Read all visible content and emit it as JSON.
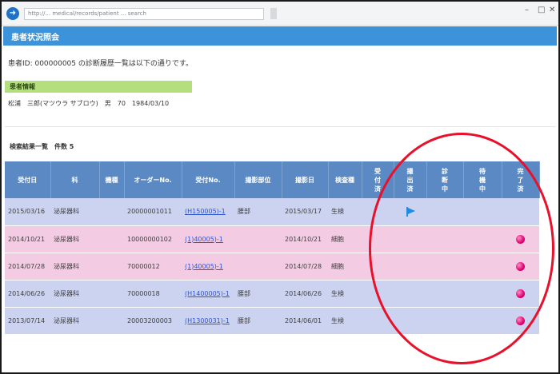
{
  "browser": {
    "url": "http://... medical/records/patient ... search",
    "tab_text": ""
  },
  "header": {
    "title": "患者状況照会"
  },
  "intro_text": "患者ID: 000000005 の診断履歴一覧は以下の通りです。",
  "patient_info": {
    "section_label": "患者情報",
    "line": "松浦　三郎(マツウラ サブロウ)　男　70　1984/03/10"
  },
  "results": {
    "title": "検索結果一覧　件数 5",
    "columns": [
      "受付日",
      "科",
      "機種",
      "オーダーNo.",
      "受付No.",
      "撮影部位",
      "撮影日",
      "検査種",
      "受付済",
      "撮出済",
      "診断中",
      "待機中",
      "完了済"
    ],
    "rows": [
      {
        "date": "2015/03/16",
        "dept": "泌尿器科",
        "model": "",
        "order": "20000001011",
        "recv": "(H150005)-1",
        "part": "腰部",
        "shot": "2015/03/17",
        "kind": "生検",
        "status": "flag",
        "color": "blue"
      },
      {
        "date": "2014/10/21",
        "dept": "泌尿器科",
        "model": "",
        "order": "10000000102",
        "recv": "(1)40005)-1",
        "part": "",
        "shot": "2014/10/21",
        "kind": "細胞",
        "status": "done",
        "color": "pink"
      },
      {
        "date": "2014/07/28",
        "dept": "泌尿器科",
        "model": "",
        "order": "70000012",
        "recv": "(1)40005)-1",
        "part": "",
        "shot": "2014/07/28",
        "kind": "細胞",
        "status": "done",
        "color": "pink"
      },
      {
        "date": "2014/06/26",
        "dept": "泌尿器科",
        "model": "",
        "order": "70000018",
        "recv": "(H1400005)-1",
        "part": "腰部",
        "shot": "2014/06/26",
        "kind": "生検",
        "status": "done",
        "color": "blue"
      },
      {
        "date": "2013/07/14",
        "dept": "泌尿器科",
        "model": "",
        "order": "20003200003",
        "recv": "(H1300031)-1",
        "part": "腰部",
        "shot": "2014/06/01",
        "kind": "生検",
        "status": "done",
        "color": "blue"
      }
    ]
  },
  "icons": {
    "back": "back-arrow-icon",
    "flag": "flag-icon",
    "done": "pink-dot-icon"
  },
  "colors": {
    "header": "#3d93d9",
    "table_head": "#5b89c3",
    "row_blue": "#ccd3f0",
    "row_pink": "#f3cbe2",
    "info_band": "#b5df7e",
    "annotation": "#e8102a"
  }
}
